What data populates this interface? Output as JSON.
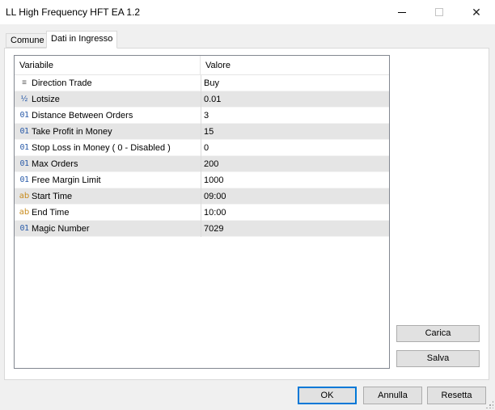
{
  "window": {
    "title": "LL High Frequency HFT EA 1.2",
    "minimize_glyph": "",
    "close_glyph": "✕"
  },
  "tabs": [
    {
      "label": "Comune",
      "active": false
    },
    {
      "label": "Dati in Ingresso",
      "active": true
    }
  ],
  "grid": {
    "headers": {
      "variable": "Variabile",
      "value": "Valore"
    },
    "rows": [
      {
        "icon": "enum-icon",
        "glyph": "≡",
        "name": "Direction Trade",
        "value": "Buy"
      },
      {
        "icon": "double-icon",
        "glyph": "½",
        "name": "Lotsize",
        "value": "0.01"
      },
      {
        "icon": "integer-icon",
        "glyph": "01",
        "name": "Distance Between Orders",
        "value": "3"
      },
      {
        "icon": "integer-icon",
        "glyph": "01",
        "name": "Take Profit in Money",
        "value": "15"
      },
      {
        "icon": "integer-icon",
        "glyph": "01",
        "name": "Stop Loss in Money ( 0 - Disabled )",
        "value": "0"
      },
      {
        "icon": "integer-icon",
        "glyph": "01",
        "name": "Max Orders",
        "value": "200"
      },
      {
        "icon": "integer-icon",
        "glyph": "01",
        "name": "Free Margin Limit",
        "value": "1000"
      },
      {
        "icon": "string-icon",
        "glyph": "ab",
        "name": "Start Time",
        "value": "09:00"
      },
      {
        "icon": "string-icon",
        "glyph": "ab",
        "name": "End Time",
        "value": "10:00"
      },
      {
        "icon": "integer-icon",
        "glyph": "01",
        "name": "Magic Number",
        "value": "7029"
      }
    ]
  },
  "side_buttons": {
    "load": "Carica",
    "save": "Salva"
  },
  "footer_buttons": {
    "ok": "OK",
    "cancel": "Annulla",
    "reset": "Resetta"
  },
  "colors": {
    "accent": "#0078d7",
    "row_alt": "#e5e5e5",
    "integer_icon": "#2a5ba8",
    "string_icon": "#c88a1a"
  }
}
